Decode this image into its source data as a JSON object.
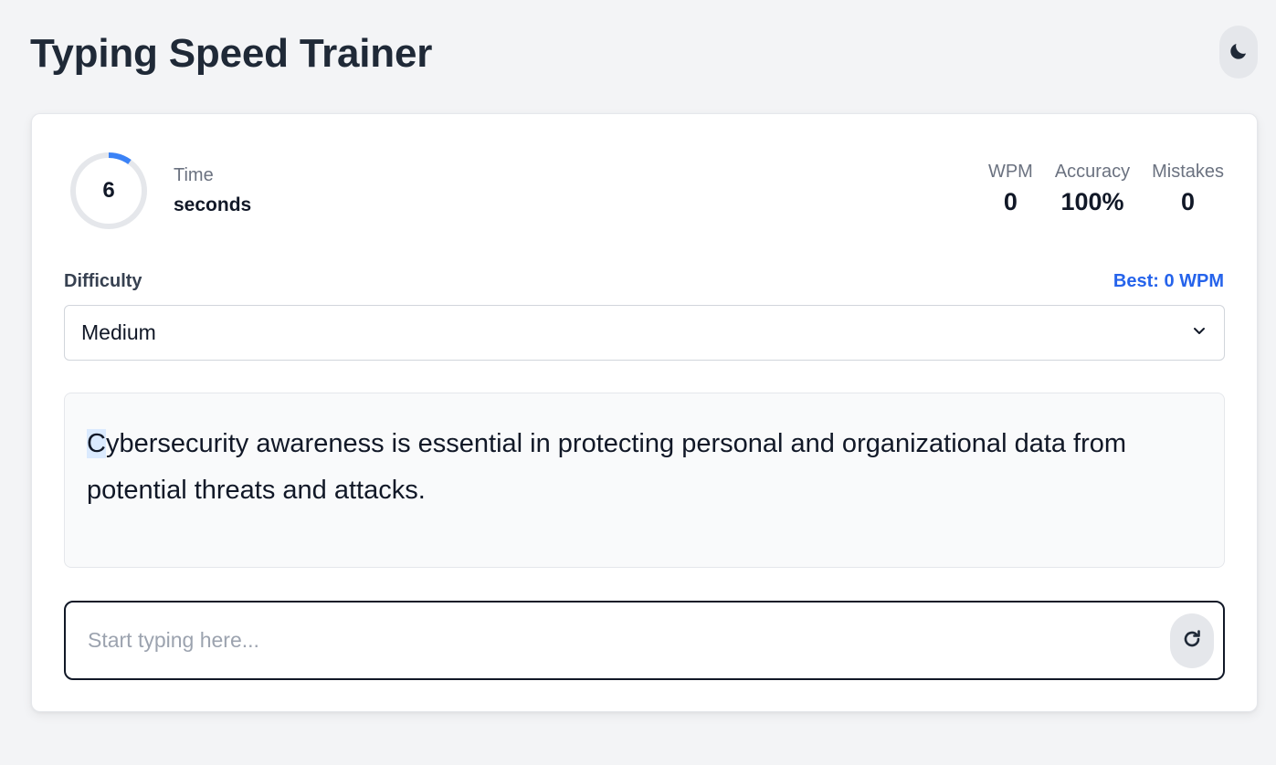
{
  "header": {
    "title": "Typing Speed Trainer",
    "theme_icon": "moon-icon"
  },
  "timer": {
    "value": "6",
    "label": "Time",
    "unit": "seconds",
    "progress": 0.1
  },
  "stats": [
    {
      "label": "WPM",
      "value": "0"
    },
    {
      "label": "Accuracy",
      "value": "100%"
    },
    {
      "label": "Mistakes",
      "value": "0"
    }
  ],
  "difficulty": {
    "label": "Difficulty",
    "selected": "Medium"
  },
  "best": "Best: 0 WPM",
  "passage": {
    "current_char": "C",
    "rest": "ybersecurity awareness is essential in protecting personal and organizational data from potential threats and attacks."
  },
  "input": {
    "placeholder": "Start typing here...",
    "value": ""
  },
  "colors": {
    "accent": "#3b82f6",
    "best_text": "#2563eb",
    "ring_track": "#e5e7eb"
  },
  "icons": {
    "theme": "moon-icon",
    "restart": "refresh-icon",
    "select": "chevron-down-icon"
  }
}
